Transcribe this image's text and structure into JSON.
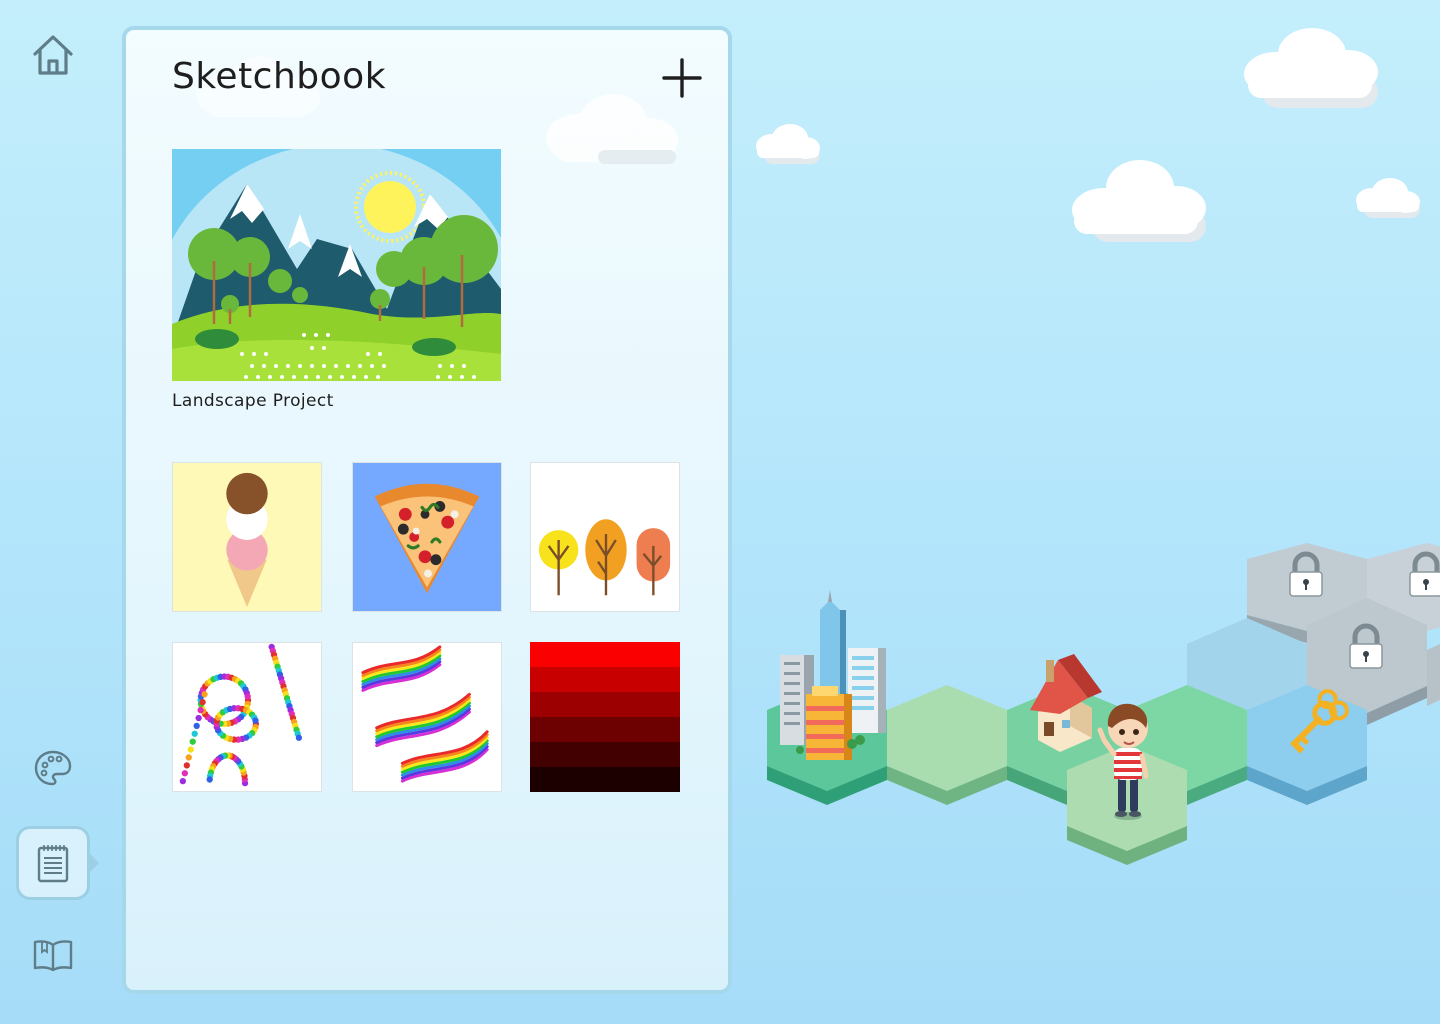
{
  "nav": {
    "items": [
      {
        "id": "home",
        "icon": "home-icon"
      },
      {
        "id": "palette",
        "icon": "palette-icon"
      },
      {
        "id": "sketchbook",
        "icon": "notepad-icon",
        "active": true
      },
      {
        "id": "book",
        "icon": "book-icon"
      }
    ]
  },
  "sketchbook": {
    "title": "Sketchbook",
    "add_icon": "plus-icon",
    "featured": {
      "label": "Landscape Project"
    },
    "drawings": [
      {
        "name": "ice-cream"
      },
      {
        "name": "pizza"
      },
      {
        "name": "trees"
      },
      {
        "name": "dots-doodle"
      },
      {
        "name": "rainbow-stripes"
      },
      {
        "name": "red-gradient"
      }
    ]
  },
  "world": {
    "locked_icon": "padlock-icon",
    "key_icon": "key-icon",
    "character": "boy-character"
  },
  "colors": {
    "panel_border": "#a6d8ec",
    "nav_icon": "#5e7d88",
    "sky": "#b2e5fb"
  }
}
